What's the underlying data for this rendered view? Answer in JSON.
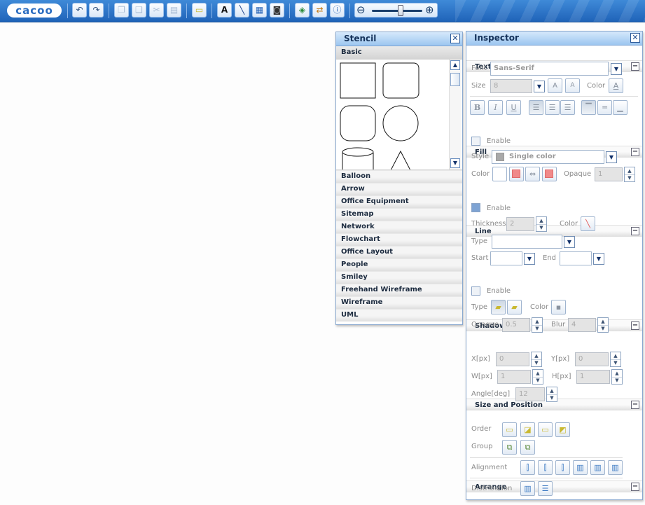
{
  "app": {
    "logo": "cacoo"
  },
  "toolbar": {
    "buttons": [
      {
        "name": "undo-icon",
        "glyph": "↶"
      },
      {
        "name": "redo-icon",
        "glyph": "↷"
      },
      {
        "name": "copy-icon",
        "glyph": "❐"
      },
      {
        "name": "paste-icon",
        "glyph": "❑"
      },
      {
        "name": "cut-icon",
        "glyph": "✂"
      },
      {
        "name": "clipboard-icon",
        "glyph": "▤"
      },
      {
        "name": "sticky-note-icon",
        "glyph": "▭"
      },
      {
        "name": "text-tool-icon",
        "glyph": "A"
      },
      {
        "name": "line-tool-icon",
        "glyph": "╲"
      },
      {
        "name": "image-icon",
        "glyph": "▦"
      },
      {
        "name": "camera-icon",
        "glyph": "◙"
      },
      {
        "name": "shapes-icon",
        "glyph": "◈"
      },
      {
        "name": "share-icon",
        "glyph": "⇄"
      },
      {
        "name": "info-icon",
        "glyph": "ⓘ"
      },
      {
        "name": "zoom-out-icon",
        "glyph": "⊖"
      },
      {
        "name": "zoom-in-icon",
        "glyph": "⊕"
      }
    ]
  },
  "stencil": {
    "title": "Stencil",
    "active_category": "Basic",
    "categories": [
      "Balloon",
      "Arrow",
      "Office Equipment",
      "Sitemap",
      "Network",
      "Flowchart",
      "Office Layout",
      "People",
      "Smiley",
      "Freehand Wireframe",
      "Wireframe",
      "UML"
    ]
  },
  "inspector": {
    "title": "Inspector",
    "text": {
      "header": "Text",
      "font_label": "Font",
      "font_value": "Sans-Serif",
      "size_label": "Size",
      "size_value": "8",
      "color_label": "Color",
      "bold": "B",
      "italic": "I",
      "underline": "U",
      "grow_icon": "A",
      "shrink_icon": "A",
      "color_icon": "A"
    },
    "fill": {
      "header": "Fill",
      "enable": "Enable",
      "style_label": "Style",
      "style_value": "Single color",
      "color_label": "Color",
      "opaque_label": "Opaque",
      "opaque_value": "1"
    },
    "line": {
      "header": "Line",
      "enable": "Enable",
      "thickness_label": "Thickness",
      "thickness_value": "2",
      "color_label": "Color",
      "type_label": "Type",
      "start_label": "Start",
      "end_label": "End"
    },
    "shadow": {
      "header": "Shadow",
      "enable": "Enable",
      "type_label": "Type",
      "color_label": "Color",
      "opaque_label": "Opaque",
      "opaque_value": "0.5",
      "blur_label": "Blur",
      "blur_value": "4"
    },
    "size_position": {
      "header": "Size and Position",
      "x_label": "X[px]",
      "x_value": "0",
      "y_label": "Y[px]",
      "y_value": "0",
      "w_label": "W[px]",
      "w_value": "1",
      "h_label": "H[px]",
      "h_value": "1",
      "angle_label": "Angle[deg]",
      "angle_value": "12"
    },
    "arrange": {
      "header": "Arrange",
      "order_label": "Order",
      "group_label": "Group",
      "alignment_label": "Alignment",
      "distribution_label": "Distribution"
    }
  },
  "colors": {
    "toolbar": "#2a72c9",
    "panel_title": "#b5d6f6",
    "accent_red": "#f08a8a",
    "fill_swatch": "#a9a9a9"
  }
}
